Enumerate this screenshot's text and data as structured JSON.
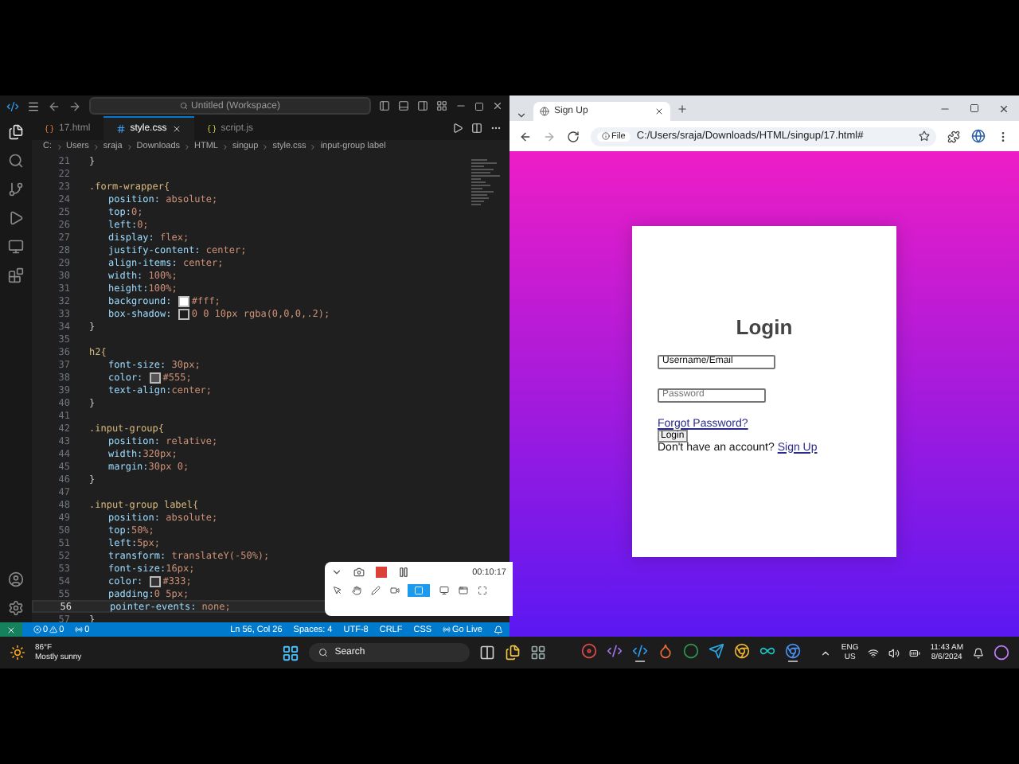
{
  "editor": {
    "command_center": "Untitled (Workspace)",
    "tabs": [
      {
        "label": "17.html",
        "kind": "html",
        "selected": false
      },
      {
        "label": "style.css",
        "kind": "css",
        "selected": true
      },
      {
        "label": "script.js",
        "kind": "js",
        "selected": false
      }
    ],
    "breadcrumbs": [
      "C:",
      "Users",
      "sraja",
      "Downloads",
      "HTML",
      "singup",
      "style.css",
      "input-group label"
    ],
    "lines": [
      {
        "number": "21",
        "kind": "brace",
        "text": "}",
        "active": false
      },
      {
        "number": "22",
        "kind": "blank",
        "active": false
      },
      {
        "number": "23",
        "kind": "selector",
        "text": ".form-wrapper{",
        "active": false
      },
      {
        "number": "24",
        "kind": "declaration",
        "text": "position: absolute;",
        "active": false
      },
      {
        "number": "25",
        "kind": "declaration",
        "text": "top:0;",
        "active": false
      },
      {
        "number": "26",
        "kind": "declaration",
        "text": "left:0;",
        "active": false
      },
      {
        "number": "27",
        "kind": "declaration",
        "text": "display: flex;",
        "active": false
      },
      {
        "number": "28",
        "kind": "declaration",
        "text": "justify-content: center;",
        "active": false
      },
      {
        "number": "29",
        "kind": "declaration",
        "text": "align-items: center;",
        "active": false
      },
      {
        "number": "30",
        "kind": "declaration",
        "text": "width: 100%;",
        "active": false
      },
      {
        "number": "31",
        "kind": "declaration",
        "text": "height:100%;",
        "active": false
      },
      {
        "number": "32",
        "kind": "declaration",
        "text": "background: #fff;",
        "color": "#ffffff",
        "active": false
      },
      {
        "number": "33",
        "kind": "declaration",
        "text": "box-shadow: 0 0 10px rgba(0,0,0,.2);",
        "color": "#1e1e1e",
        "active": false
      },
      {
        "number": "34",
        "kind": "brace",
        "text": "}",
        "active": false
      },
      {
        "number": "35",
        "kind": "blank",
        "active": false
      },
      {
        "number": "36",
        "kind": "selector",
        "text": "h2{",
        "active": false
      },
      {
        "number": "37",
        "kind": "declaration",
        "text": "font-size: 30px;",
        "active": false
      },
      {
        "number": "38",
        "kind": "declaration",
        "text": "color: #555;",
        "color": "#555555",
        "active": false
      },
      {
        "number": "39",
        "kind": "declaration",
        "text": "text-align:center;",
        "active": false
      },
      {
        "number": "40",
        "kind": "brace",
        "text": "}",
        "active": false
      },
      {
        "number": "41",
        "kind": "blank",
        "active": false
      },
      {
        "number": "42",
        "kind": "selector",
        "text": ".input-group{",
        "active": false
      },
      {
        "number": "43",
        "kind": "declaration",
        "text": "position: relative;",
        "active": false
      },
      {
        "number": "44",
        "kind": "declaration",
        "text": "width:320px;",
        "active": false
      },
      {
        "number": "45",
        "kind": "declaration",
        "text": "margin:30px 0;",
        "active": false
      },
      {
        "number": "46",
        "kind": "brace",
        "text": "}",
        "active": false
      },
      {
        "number": "47",
        "kind": "blank",
        "active": false
      },
      {
        "number": "48",
        "kind": "selector",
        "text": ".input-group label{",
        "active": false
      },
      {
        "number": "49",
        "kind": "declaration",
        "text": "position: absolute;",
        "active": false
      },
      {
        "number": "50",
        "kind": "declaration",
        "text": "top:50%;",
        "active": false
      },
      {
        "number": "51",
        "kind": "declaration",
        "text": "left:5px;",
        "active": false
      },
      {
        "number": "52",
        "kind": "declaration",
        "text": "transform: translateY(-50%);",
        "active": false
      },
      {
        "number": "53",
        "kind": "declaration",
        "text": "font-size:16px;",
        "active": false
      },
      {
        "number": "54",
        "kind": "declaration",
        "text": "color: #333;",
        "color": "#333333",
        "active": false
      },
      {
        "number": "55",
        "kind": "declaration",
        "text": "padding:0 5px;",
        "active": false
      },
      {
        "number": "56",
        "kind": "declaration",
        "text": "pointer-events: none;",
        "active": true
      },
      {
        "number": "57",
        "kind": "brace",
        "text": "}",
        "active": false
      }
    ],
    "status_bar": {
      "errors": "0",
      "warnings": "0",
      "ports": "0",
      "items": [
        "Ln 56, Col 26",
        "Spaces: 4",
        "UTF-8",
        "CRLF",
        "CSS"
      ],
      "go_live": "Go Live"
    }
  },
  "recorder": {
    "time": "00:10:17",
    "tools": [
      {
        "kind": "pointer",
        "selected": false
      },
      {
        "kind": "hand",
        "selected": false
      },
      {
        "kind": "pen",
        "selected": false
      },
      {
        "kind": "camera",
        "selected": false
      },
      {
        "kind": "region",
        "selected": true
      },
      {
        "kind": "monitor",
        "selected": false
      },
      {
        "kind": "window",
        "selected": false
      },
      {
        "kind": "full",
        "selected": false
      }
    ]
  },
  "browser": {
    "tab": "Sign Up",
    "url_chip": "File",
    "url": "C:/Users/sraja/Downloads/HTML/singup/17.html#",
    "form": {
      "title": "Login",
      "email_value": "Username/Email",
      "password_placeholder": "Password",
      "forgot": "Forgot Password?",
      "button": "Login",
      "prompt": "Don't have an account?",
      "signup": "Sign Up"
    }
  },
  "taskbar": {
    "temperature": "86°F",
    "weather": "Mostly sunny",
    "search": "Search",
    "apps": [
      {
        "kind": "disc",
        "active": false
      },
      {
        "kind": "studio",
        "active": false
      },
      {
        "kind": "code",
        "active": true
      },
      {
        "kind": "drop",
        "active": false
      },
      {
        "kind": "dot",
        "active": false
      },
      {
        "kind": "send",
        "active": false
      },
      {
        "kind": "browser",
        "active": false
      },
      {
        "kind": "infinity",
        "active": false
      },
      {
        "kind": "browser2",
        "active": true
      }
    ],
    "language": "ENG",
    "region": "US",
    "time": "11:43 AM",
    "date": "8/6/2024"
  }
}
